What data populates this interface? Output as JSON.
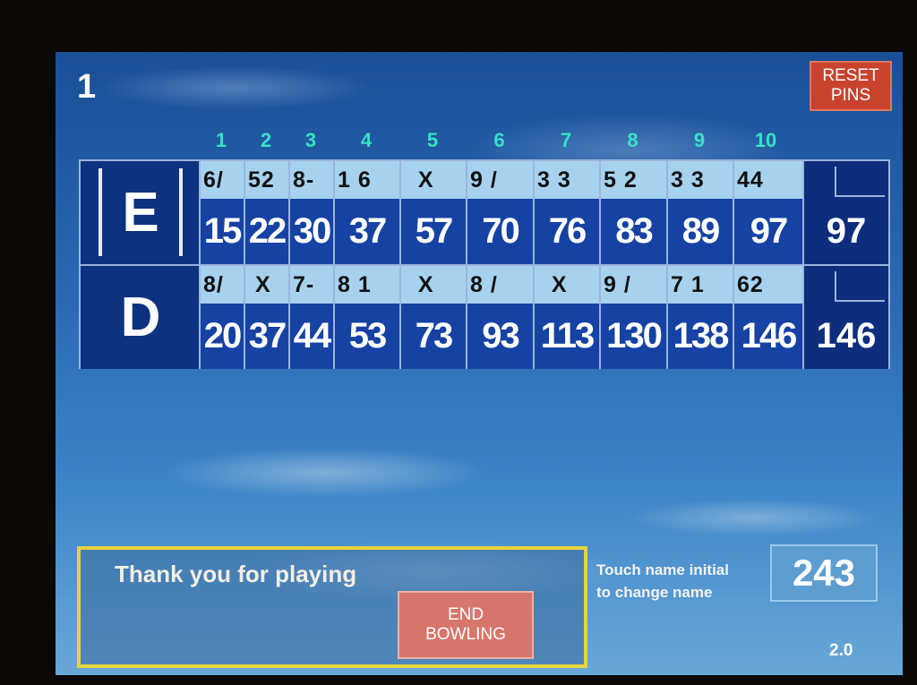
{
  "header": {
    "lane_number": "1",
    "reset_button": [
      "RESET",
      "PINS"
    ]
  },
  "frame_numbers": [
    "1",
    "2",
    "3",
    "4",
    "5",
    "6",
    "7",
    "8",
    "9",
    "10"
  ],
  "bowlers": [
    {
      "initial": "E",
      "frames": [
        {
          "balls": "6/",
          "cum": "15"
        },
        {
          "balls": "52",
          "cum": "22"
        },
        {
          "balls": "8-",
          "cum": "30"
        },
        {
          "balls": "1 6",
          "cum": "37"
        },
        {
          "balls": "  X",
          "cum": "57"
        },
        {
          "balls": "9 /",
          "cum": "70"
        },
        {
          "balls": "3 3",
          "cum": "76"
        },
        {
          "balls": "5 2",
          "cum": "83"
        },
        {
          "balls": "3 3",
          "cum": "89"
        },
        {
          "balls": "44",
          "cum": "97"
        }
      ],
      "total": "97"
    },
    {
      "initial": "D",
      "frames": [
        {
          "balls": "8/",
          "cum": "20"
        },
        {
          "balls": " X",
          "cum": "37"
        },
        {
          "balls": "7-",
          "cum": "44"
        },
        {
          "balls": "8 1",
          "cum": "53"
        },
        {
          "balls": "  X",
          "cum": "73"
        },
        {
          "balls": "8 /",
          "cum": "93"
        },
        {
          "balls": "  X",
          "cum": "113"
        },
        {
          "balls": "9 /",
          "cum": "130"
        },
        {
          "balls": "7 1",
          "cum": "138"
        },
        {
          "balls": "62",
          "cum": "146"
        }
      ],
      "total": "146"
    }
  ],
  "message": {
    "text": "Thank you for playing",
    "end_button": [
      "END",
      "BOWLING"
    ]
  },
  "hint": [
    "Touch name initial",
    "to change name"
  ],
  "score_box": "243",
  "version": "2.0"
}
